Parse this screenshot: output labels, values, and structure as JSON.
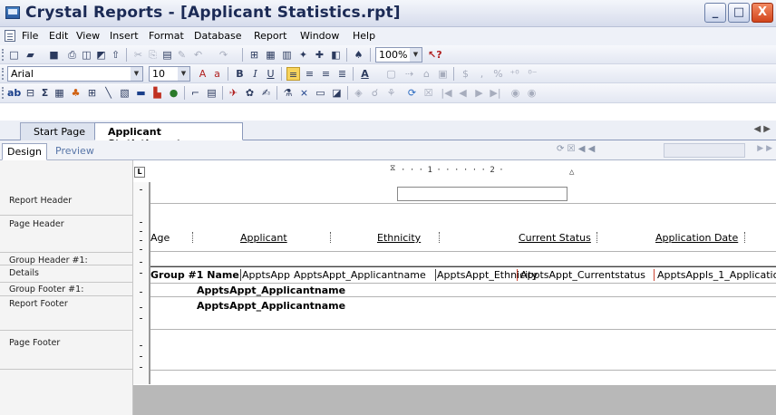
{
  "window": {
    "title": "Crystal Reports - [Applicant Statistics.rpt]",
    "min_label": "_",
    "max_label": "□",
    "close_label": "X"
  },
  "menu": [
    "File",
    "Edit",
    "View",
    "Insert",
    "Format",
    "Database",
    "Report",
    "Window",
    "Help"
  ],
  "toolbar_standard": {
    "zoom": "100%"
  },
  "toolbar_format": {
    "font": "Arial",
    "size": "10",
    "currency": "$",
    "comma": ",",
    "percent": "%"
  },
  "toolbar_insert": {
    "text_object": "ab",
    "sum": "Σ"
  },
  "tabs": {
    "start_page": "Start Page",
    "document": "Applicant Statistics.rpt",
    "close": "×"
  },
  "view_tabs": {
    "design": "Design",
    "preview": "Preview"
  },
  "ruler": {
    "corner": "L",
    "marks": "· · · 1 · · · · · · 2 ·"
  },
  "sections": {
    "report_header": "Report Header",
    "page_header": "Page Header",
    "group_header": "Group Header #1:",
    "details": "Details",
    "group_footer": "Group Footer #1:",
    "report_footer": "Report Footer",
    "page_footer": "Page Footer"
  },
  "page_header_fields": {
    "age": "Age",
    "applicant": "Applicant",
    "ethnicity": "Ethnicity",
    "current_status": "Current Status",
    "application_date": "Application Date"
  },
  "details_fields": {
    "group_name": "Group #1 Name",
    "appts_app": "ApptsApp",
    "applicant_name": "ApptsAppt_Applicantname",
    "ethnicity": "ApptsAppt_Ethnicity",
    "current_status": "ApptsAppt_Currentstatus",
    "application_date": "ApptsAppls_1_Applicatio"
  },
  "group_footer_field": "ApptsAppt_Applicantname",
  "report_footer_field": "ApptsAppt_Applicantname",
  "colors": {
    "title_text": "#1b2a55",
    "close_button": "#d2451c",
    "ruler_guide": "#cc4433"
  }
}
